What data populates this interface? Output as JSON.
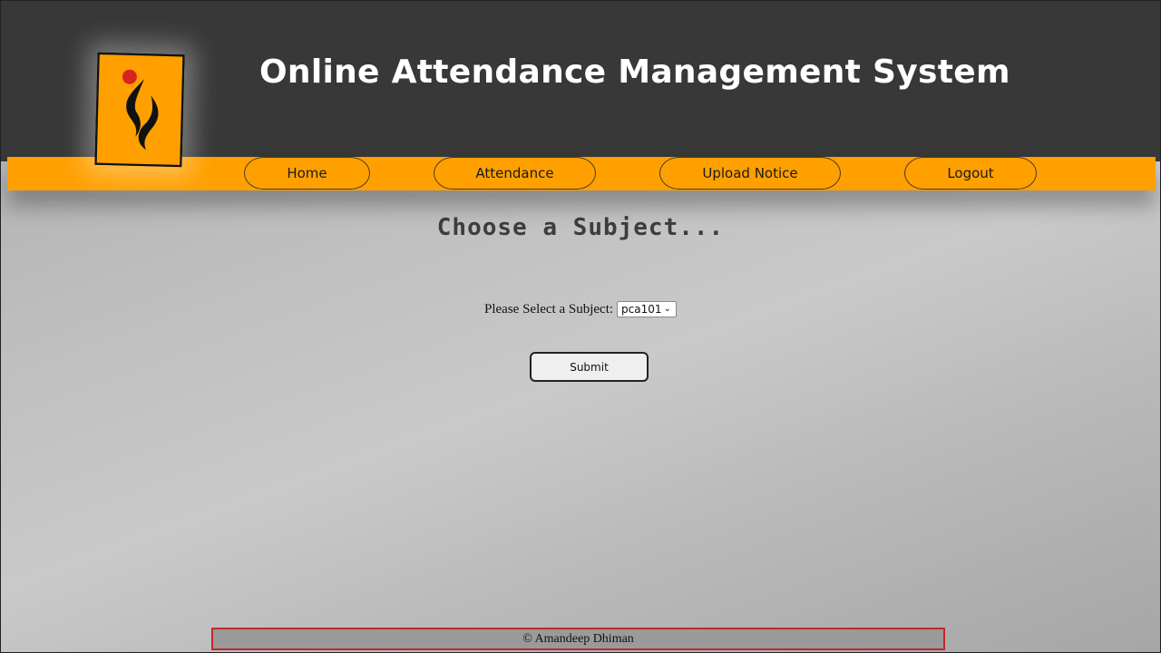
{
  "header": {
    "title": "Online Attendance Management System",
    "logo_icon": "flame-emblem-logo",
    "accent_color": "#ffa000",
    "background_color": "#383838"
  },
  "nav": {
    "items": [
      {
        "label": "Home"
      },
      {
        "label": "Attendance"
      },
      {
        "label": "Upload Notice"
      },
      {
        "label": "Logout"
      }
    ]
  },
  "main": {
    "heading": "Choose a Subject...",
    "subject_label": "Please Select a Subject:",
    "subject_selected": "pca101",
    "submit_label": "Submit"
  },
  "footer": {
    "text": "© Amandeep Dhiman"
  }
}
